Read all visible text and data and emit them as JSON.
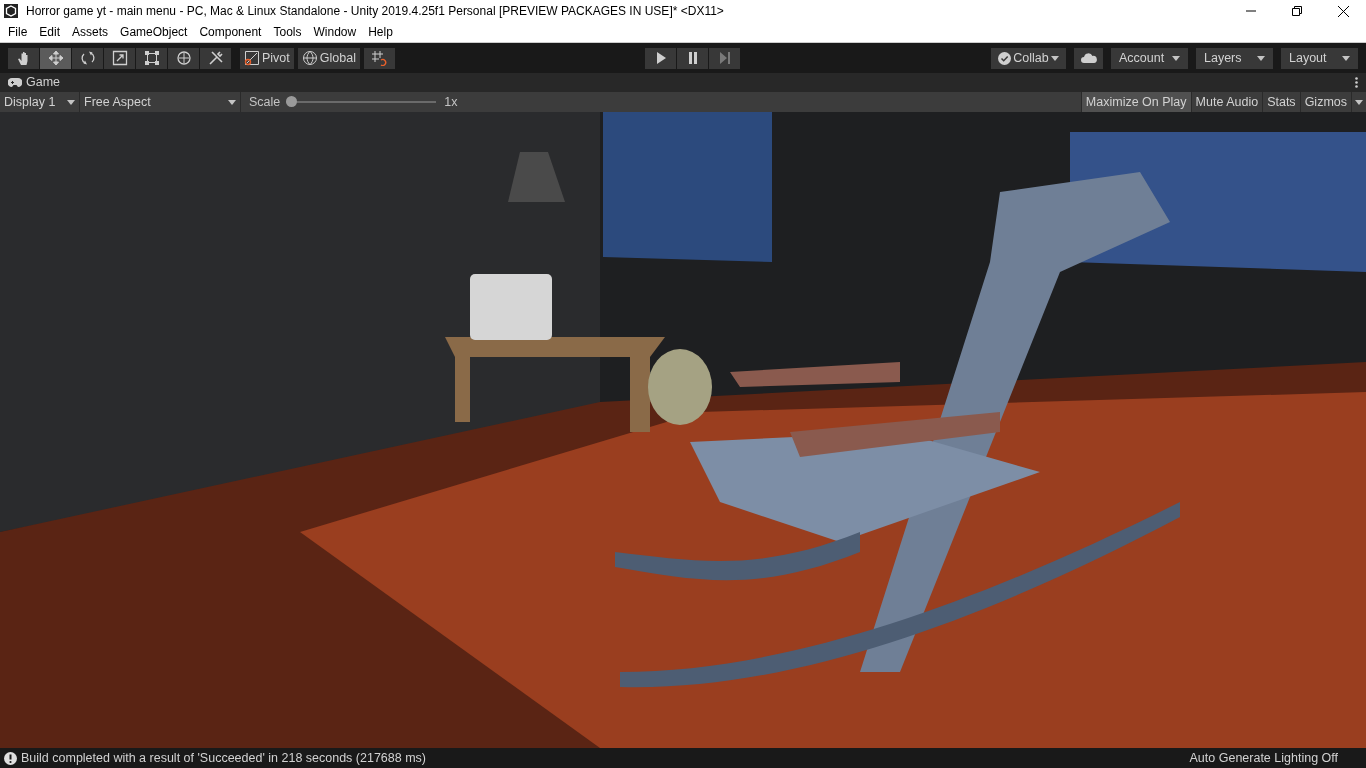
{
  "window": {
    "title": "Horror game yt - main menu - PC, Mac & Linux Standalone - Unity 2019.4.25f1 Personal [PREVIEW PACKAGES IN USE]* <DX11>"
  },
  "menu": [
    "File",
    "Edit",
    "Assets",
    "GameObject",
    "Component",
    "Tools",
    "Window",
    "Help"
  ],
  "tools": [
    {
      "kind": "hand",
      "selected": false
    },
    {
      "kind": "move",
      "selected": true
    },
    {
      "kind": "rotate",
      "selected": false
    },
    {
      "kind": "scale",
      "selected": false
    },
    {
      "kind": "rect",
      "selected": false
    },
    {
      "kind": "transform",
      "selected": false
    },
    {
      "kind": "custom",
      "selected": false
    }
  ],
  "handle_buttons": [
    {
      "kind": "pivot",
      "label": "Pivot"
    },
    {
      "kind": "global",
      "label": "Global"
    }
  ],
  "playback": [
    {
      "kind": "play"
    },
    {
      "kind": "pause"
    },
    {
      "kind": "step"
    }
  ],
  "collab": {
    "label": "Collab"
  },
  "right_dropdowns": [
    {
      "label": "Account"
    },
    {
      "label": "Layers"
    },
    {
      "label": "Layout"
    }
  ],
  "tab": {
    "label": "Game"
  },
  "game_toolbar": {
    "display": "Display 1",
    "aspect": "Free Aspect",
    "scale_label": "Scale",
    "scale": {
      "level": 0.0
    },
    "scale_reading": "1x",
    "toggles": [
      {
        "label": "Maximize On Play",
        "on": true
      },
      {
        "label": "Mute Audio",
        "on": false
      },
      {
        "label": "Stats",
        "on": false
      },
      {
        "label": "Gizmos",
        "on": false
      }
    ]
  },
  "status_bar": {
    "message": "Build completed with a result of 'Succeeded' in 218 seconds (217688 ms)",
    "lighting": "Auto Generate Lighting Off"
  }
}
